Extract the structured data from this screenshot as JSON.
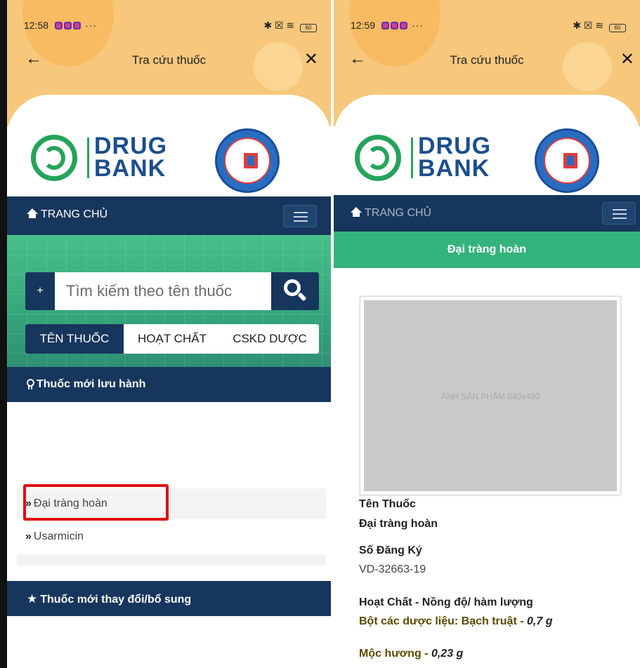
{
  "left": {
    "status": {
      "time": "12:58",
      "dots": "···",
      "right_icons": "✱ ☒ ≋",
      "battery": "60"
    },
    "appbar": {
      "title": "Tra cứu thuốc",
      "back": "←",
      "close": "✕"
    },
    "logo": {
      "word1": "DRUG",
      "word2": "BANK"
    },
    "nav": {
      "home": "TRANG CHỦ"
    },
    "search": {
      "plus": "+",
      "placeholder": "Tìm kiếm theo tên thuốc"
    },
    "tabs": [
      "TÊN THUỐC",
      "HOẠT CHẤT",
      "CSKD DƯỢC"
    ],
    "section_new": "Thuốc mới lưu hành",
    "list": [
      "Đại tràng hoàn",
      "Usarmicin"
    ],
    "section_changed": "Thuốc mới thay đổi/bổ sung"
  },
  "right": {
    "status": {
      "time": "12:59",
      "dots": "···",
      "right_icons": "✱ ☒ ≋",
      "battery": "60"
    },
    "appbar": {
      "title": "Tra cứu thuốc",
      "back": "←",
      "close": "✕"
    },
    "logo": {
      "word1": "DRUG",
      "word2": "BANK"
    },
    "nav": {
      "home": "TRANG CHỦ"
    },
    "drug_title": "Đại tràng hoàn",
    "image_placeholder": "ẢNH SẢN PHẨM 640x480",
    "fields": {
      "name_label": "Tên Thuốc",
      "name_value": "Đại tràng hoàn",
      "reg_label": "Số Đăng Ký",
      "reg_value": "VD-32663-19",
      "ingredients_label": "Hoạt Chất - Nồng độ/ hàm lượng"
    },
    "ingredients": [
      {
        "name": "Bột các dược liệu: Bạch truật",
        "sep": " - ",
        "amount": "0,7 g"
      },
      {
        "name": "Mộc hương",
        "sep": " - ",
        "amount": "0,23 g"
      }
    ]
  },
  "colors": {
    "navy": "#17365d",
    "green": "#34b37d",
    "orange": "#f7c77c",
    "highlight": "#e00d0d"
  },
  "icons": [
    "back-arrow-icon",
    "close-icon",
    "home-icon",
    "menu-icon",
    "search-icon",
    "award-icon",
    "star-icon",
    "chevron-double-right-icon"
  ]
}
